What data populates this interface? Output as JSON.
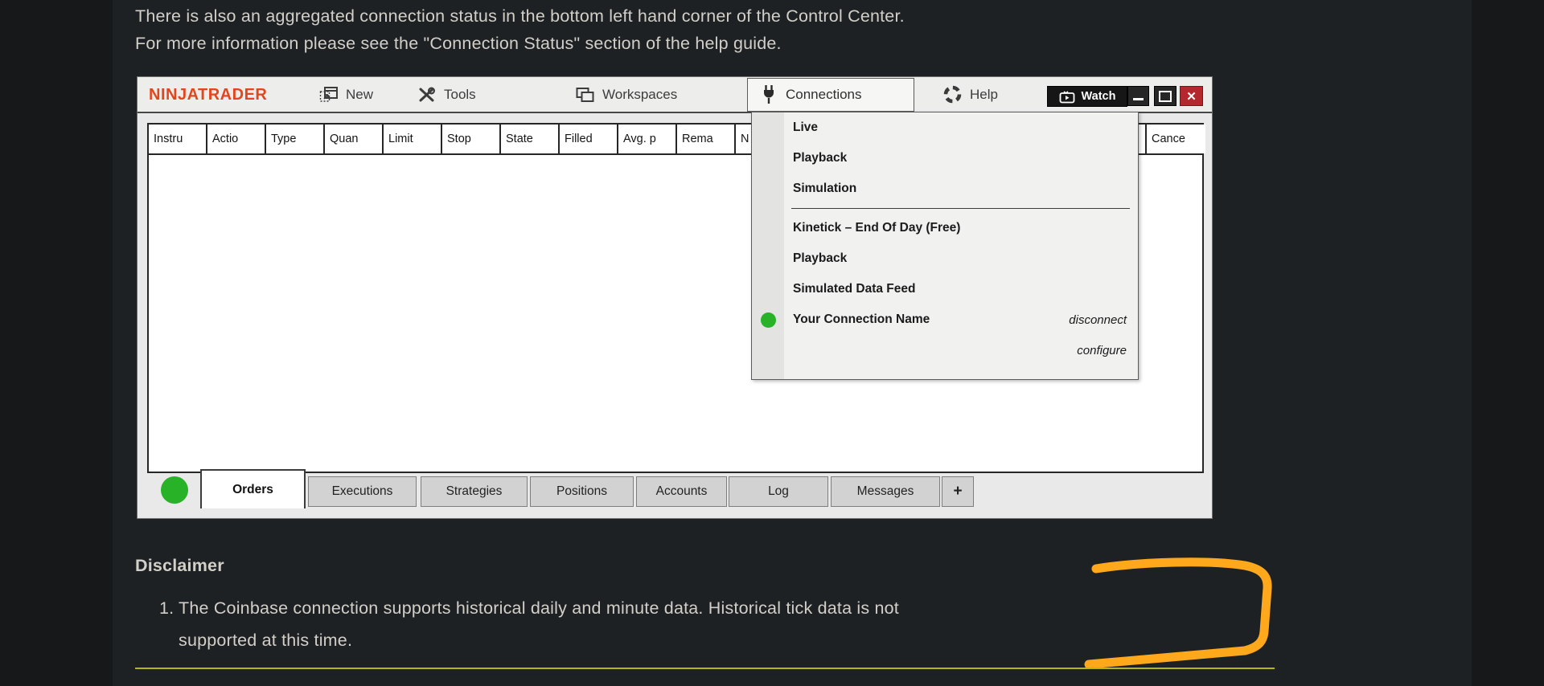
{
  "intro": {
    "line1": "There is also an aggregated connection status in the bottom left hand corner of the Control Center.",
    "line2": "For more information please see the \"Connection Status\" section of the help guide."
  },
  "disclaimer": {
    "heading": "Disclaimer",
    "item_number": "1.",
    "item_line1": "The Coinbase connection supports historical daily and minute data. Historical tick data is not",
    "item_line2": "supported at this time."
  },
  "window": {
    "logo": "NINJATRADER",
    "menubar": {
      "new": "New",
      "tools": "Tools",
      "workspaces": "Workspaces",
      "connections": "Connections",
      "help": "Help"
    },
    "watch_label": "Watch",
    "close_glyph": "✕",
    "table_headers": [
      "Instru",
      "Actio",
      "Type",
      "Quan",
      "Limit",
      "Stop",
      "State",
      "Filled",
      "Avg. p",
      "Rema",
      "N",
      "Cance"
    ],
    "connections_menu": {
      "items": [
        {
          "label": "Live"
        },
        {
          "label": "Playback"
        },
        {
          "label": "Simulation"
        },
        {
          "label": "Kinetick – End Of Day (Free)"
        },
        {
          "label": "Playback"
        },
        {
          "label": "Simulated Data Feed"
        },
        {
          "label": "Your Connection Name",
          "action": "disconnect",
          "connected": true
        },
        {
          "label": "",
          "action": "configure"
        }
      ]
    },
    "tabs": [
      {
        "label": "Orders",
        "active": true
      },
      {
        "label": "Executions"
      },
      {
        "label": "Strategies"
      },
      {
        "label": "Positions"
      },
      {
        "label": "Accounts"
      },
      {
        "label": "Log"
      },
      {
        "label": "Messages"
      },
      {
        "label": "+"
      }
    ]
  },
  "colors": {
    "logo_orange": "#e2461c",
    "status_green": "#27b227",
    "annotation_orange": "#ffa81c",
    "divider_olive": "#b6b618",
    "close_red": "#b3282e",
    "page_background": "#1e2124"
  }
}
